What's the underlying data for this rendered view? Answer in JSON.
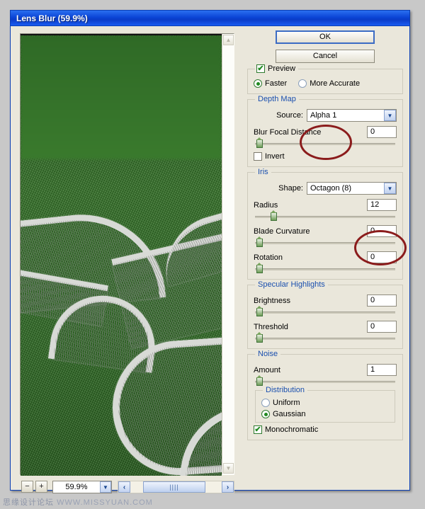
{
  "window": {
    "title": "Lens Blur (59.9%)"
  },
  "buttons": {
    "ok": "OK",
    "cancel": "Cancel"
  },
  "preview_group": {
    "checkbox_label": "Preview",
    "checked": true,
    "radio_faster": "Faster",
    "radio_more_accurate": "More Accurate",
    "selected": "Faster"
  },
  "depth_map": {
    "legend": "Depth Map",
    "source_label": "Source:",
    "source_value": "Alpha 1",
    "blur_focal_distance_label": "Blur Focal Distance",
    "blur_focal_distance_value": "0",
    "blur_focal_distance_percent": 2,
    "invert_label": "Invert",
    "invert_checked": false
  },
  "iris": {
    "legend": "Iris",
    "shape_label": "Shape:",
    "shape_value": "Octagon (8)",
    "radius_label": "Radius",
    "radius_value": "12",
    "radius_percent": 12,
    "blade_curvature_label": "Blade Curvature",
    "blade_curvature_value": "0",
    "blade_curvature_percent": 2,
    "rotation_label": "Rotation",
    "rotation_value": "0",
    "rotation_percent": 2
  },
  "specular_highlights": {
    "legend": "Specular Highlights",
    "brightness_label": "Brightness",
    "brightness_value": "0",
    "brightness_percent": 2,
    "threshold_label": "Threshold",
    "threshold_value": "0",
    "threshold_percent": 2
  },
  "noise": {
    "legend": "Noise",
    "amount_label": "Amount",
    "amount_value": "1",
    "amount_percent": 2,
    "distribution_legend": "Distribution",
    "uniform_label": "Uniform",
    "gaussian_label": "Gaussian",
    "distribution_selected": "Gaussian",
    "monochromatic_label": "Monochromatic",
    "monochromatic_checked": true
  },
  "zoom_bar": {
    "minus": "−",
    "plus": "+",
    "zoom_value": "59.9%",
    "left_arrow": "‹",
    "right_arrow": "›",
    "grip": "||||"
  },
  "icons": {
    "check": "✔",
    "chevron_down": "▼",
    "chevron_up": "▲"
  },
  "watermark": {
    "cn": "思缘设计论坛",
    "url": "WWW.MISSYUAN.COM"
  },
  "colors": {
    "titlebar_blue": "#0b45d6",
    "panel_bg": "#eae7db",
    "legend_blue": "#1a4fae",
    "annotation_red": "#8b1c1c",
    "slider_green": "#1f8a1f",
    "fabric_green": "#38722c"
  }
}
